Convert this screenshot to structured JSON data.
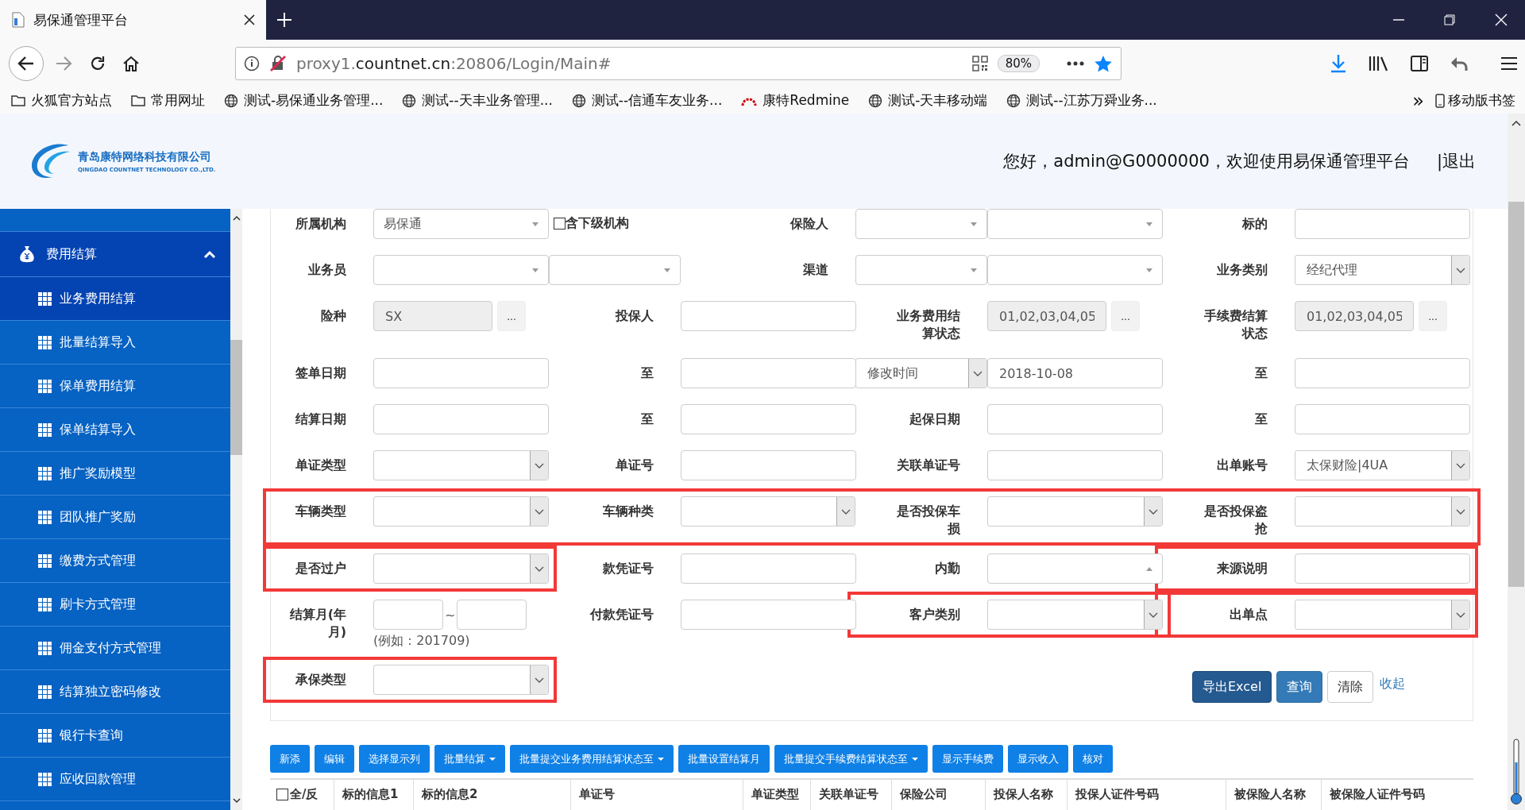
{
  "browser": {
    "tab": {
      "title": "易保通管理平台"
    },
    "address": {
      "prefix": "proxy1.",
      "domain": "countnet.cn",
      "suffix": ":20806/Login/Main#"
    },
    "zoom": "80%",
    "bookmarks": [
      {
        "kind": "folder",
        "label": "火狐官方站点"
      },
      {
        "kind": "folder",
        "label": "常用网址"
      },
      {
        "kind": "globe",
        "label": "测试-易保通业务管理..."
      },
      {
        "kind": "globe",
        "label": "测试--天丰业务管理..."
      },
      {
        "kind": "globe",
        "label": "测试--信通车友业务..."
      },
      {
        "kind": "gauge",
        "label": "康特Redmine"
      },
      {
        "kind": "globe",
        "label": "测试-天丰移动端"
      },
      {
        "kind": "globe",
        "label": "测试--江苏万舜业务..."
      }
    ],
    "overflow": "»",
    "mobile_bookmarks": "移动版书签"
  },
  "header": {
    "company": "青岛康特网络科技有限公司",
    "company_en": "QINGDAO COUNTNET TECHNOLOGY CO.,LTD.",
    "greeting": "您好，admin@G0000000，欢迎使用易保通管理平台",
    "logout": "|退出"
  },
  "sidebar": {
    "group": {
      "label": "费用结算",
      "expanded": true
    },
    "items": [
      {
        "label": "业务费用结算",
        "selected": true
      },
      {
        "label": "批量结算导入",
        "selected": false
      },
      {
        "label": "保单费用结算",
        "selected": false
      },
      {
        "label": "保单结算导入",
        "selected": false
      },
      {
        "label": "推广奖励模型",
        "selected": false
      },
      {
        "label": "团队推广奖励",
        "selected": false
      },
      {
        "label": "缴费方式管理",
        "selected": false
      },
      {
        "label": "刷卡方式管理",
        "selected": false
      },
      {
        "label": "佣金支付方式管理",
        "selected": false
      },
      {
        "label": "结算独立密码修改",
        "selected": false
      },
      {
        "label": "银行卡查询",
        "selected": false
      },
      {
        "label": "应收回款管理",
        "selected": false
      }
    ]
  },
  "form": {
    "rows": [
      {
        "highlighted": false,
        "cells": [
          {
            "kind": "label",
            "label": "所属机构",
            "highlighted": false
          },
          {
            "kind": "combo",
            "value": "易保通",
            "open": false
          },
          {
            "kind": "checkbox",
            "label": "含下级机构",
            "checked": false
          },
          {
            "kind": "label",
            "label": "保险人",
            "highlighted": false
          },
          {
            "kind": "combo",
            "open": false
          },
          {
            "kind": "combo",
            "open": false
          },
          {
            "kind": "label",
            "label": "标的",
            "highlighted": false
          },
          {
            "kind": "text"
          }
        ]
      },
      {
        "highlighted": false,
        "cells": [
          {
            "kind": "label",
            "label": "业务员",
            "highlighted": false
          },
          {
            "kind": "combo",
            "open": false
          },
          {
            "kind": "combo",
            "open": false
          },
          {
            "kind": "label",
            "label": "渠道",
            "highlighted": false
          },
          {
            "kind": "combo",
            "open": false
          },
          {
            "kind": "combo",
            "open": false
          },
          {
            "kind": "label",
            "label": "业务类别",
            "highlighted": false
          },
          {
            "kind": "select",
            "value": "经纪代理"
          }
        ]
      },
      {
        "highlighted": false,
        "cells": [
          {
            "kind": "label",
            "label": "险种",
            "highlighted": false
          },
          {
            "kind": "readonly",
            "value": "SX",
            "button": "..."
          },
          {
            "kind": "label",
            "label": "投保人",
            "highlighted": false
          },
          {
            "kind": "text"
          },
          {
            "kind": "label",
            "label": "业务费用结算状态",
            "highlighted": false
          },
          {
            "kind": "readonly",
            "value": "01,02,03,04,05",
            "button": "..."
          },
          {
            "kind": "label",
            "label": "手续费结算状态",
            "highlighted": false
          },
          {
            "kind": "readonly",
            "value": "01,02,03,04,05",
            "button": "..."
          }
        ]
      },
      {
        "highlighted": false,
        "cells": [
          {
            "kind": "label",
            "label": "签单日期",
            "highlighted": false
          },
          {
            "kind": "text"
          },
          {
            "kind": "label",
            "label": "至",
            "highlighted": false
          },
          {
            "kind": "text"
          },
          {
            "kind": "select",
            "value": "修改时间"
          },
          {
            "kind": "text",
            "value": "2018-10-08"
          },
          {
            "kind": "label",
            "label": "至",
            "highlighted": false
          },
          {
            "kind": "text"
          }
        ]
      },
      {
        "highlighted": false,
        "cells": [
          {
            "kind": "label",
            "label": "结算日期",
            "highlighted": false
          },
          {
            "kind": "text"
          },
          {
            "kind": "label",
            "label": "至",
            "highlighted": false
          },
          {
            "kind": "text"
          },
          {
            "kind": "label",
            "label": "起保日期",
            "highlighted": false
          },
          {
            "kind": "text"
          },
          {
            "kind": "label",
            "label": "至",
            "highlighted": false
          },
          {
            "kind": "text"
          }
        ]
      },
      {
        "highlighted": false,
        "cells": [
          {
            "kind": "label",
            "label": "单证类型",
            "highlighted": false
          },
          {
            "kind": "select"
          },
          {
            "kind": "label",
            "label": "单证号",
            "highlighted": false
          },
          {
            "kind": "text"
          },
          {
            "kind": "label",
            "label": "关联单证号",
            "highlighted": false
          },
          {
            "kind": "text"
          },
          {
            "kind": "label",
            "label": "出单账号",
            "highlighted": false
          },
          {
            "kind": "select",
            "value": "太保财险|4UA"
          }
        ]
      },
      {
        "highlighted": true,
        "cells": [
          {
            "kind": "label",
            "label": "车辆类型",
            "highlighted": false
          },
          {
            "kind": "select"
          },
          {
            "kind": "label",
            "label": "车辆种类",
            "highlighted": false
          },
          {
            "kind": "select"
          },
          {
            "kind": "label",
            "label": "是否投保车损",
            "highlighted": false
          },
          {
            "kind": "select"
          },
          {
            "kind": "label",
            "label": "是否投保盗抢",
            "highlighted": false
          },
          {
            "kind": "select"
          }
        ]
      },
      {
        "highlighted": false,
        "cells": [
          {
            "kind": "label",
            "label": "是否过户",
            "highlighted": true
          },
          {
            "kind": "select"
          },
          {
            "kind": "label",
            "label": "款凭证号",
            "highlighted": false
          },
          {
            "kind": "text"
          },
          {
            "kind": "label",
            "label": "内勤",
            "highlighted": false
          },
          {
            "kind": "combo",
            "open": true
          },
          {
            "kind": "label",
            "label": "来源说明",
            "highlighted": true
          },
          {
            "kind": "text"
          }
        ]
      },
      {
        "highlighted": false,
        "cells": [
          {
            "kind": "label",
            "label": "结算月(年月)",
            "highlighted": false
          },
          {
            "kind": "month-range",
            "separator": "~",
            "note": "(例如：201709)"
          },
          {
            "kind": "label",
            "label": "付款凭证号",
            "highlighted": false
          },
          {
            "kind": "text"
          },
          {
            "kind": "label",
            "label": "客户类别",
            "highlighted": true
          },
          {
            "kind": "select"
          },
          {
            "kind": "label",
            "label": "出单点",
            "highlighted": true
          },
          {
            "kind": "select"
          }
        ]
      },
      {
        "highlighted": false,
        "cells": [
          {
            "kind": "label",
            "label": "承保类型",
            "highlighted": true
          },
          {
            "kind": "select"
          },
          "",
          "",
          "",
          "",
          {
            "kind": "actions",
            "buttons": [
              {
                "kind": "export",
                "label": "导出Excel"
              },
              {
                "kind": "primary",
                "label": "查询"
              },
              {
                "kind": "default",
                "label": "清除"
              },
              {
                "kind": "link",
                "label": "收起"
              }
            ]
          }
        ]
      }
    ]
  },
  "toolbar": [
    {
      "label": "新添",
      "caret": false
    },
    {
      "label": "编辑",
      "caret": false
    },
    {
      "label": "选择显示列",
      "caret": false
    },
    {
      "label": "批量结算",
      "caret": true
    },
    {
      "label": "批量提交业务费用结算状态至",
      "caret": true
    },
    {
      "label": "批量设置结算月",
      "caret": false
    },
    {
      "label": "批量提交手续费结算状态至",
      "caret": true
    },
    {
      "label": "显示手续费",
      "caret": false
    },
    {
      "label": "显示收入",
      "caret": false
    },
    {
      "label": "核对",
      "caret": false
    }
  ],
  "table": {
    "select_all": {
      "label": "全/反",
      "checked": false
    },
    "columns": [
      "标的信息1",
      "标的信息2",
      "单证号",
      "单证类型",
      "关联单证号",
      "保险公司",
      "投保人名称",
      "投保人证件号码",
      "被保险人名称",
      "被保险人证件号码"
    ]
  }
}
